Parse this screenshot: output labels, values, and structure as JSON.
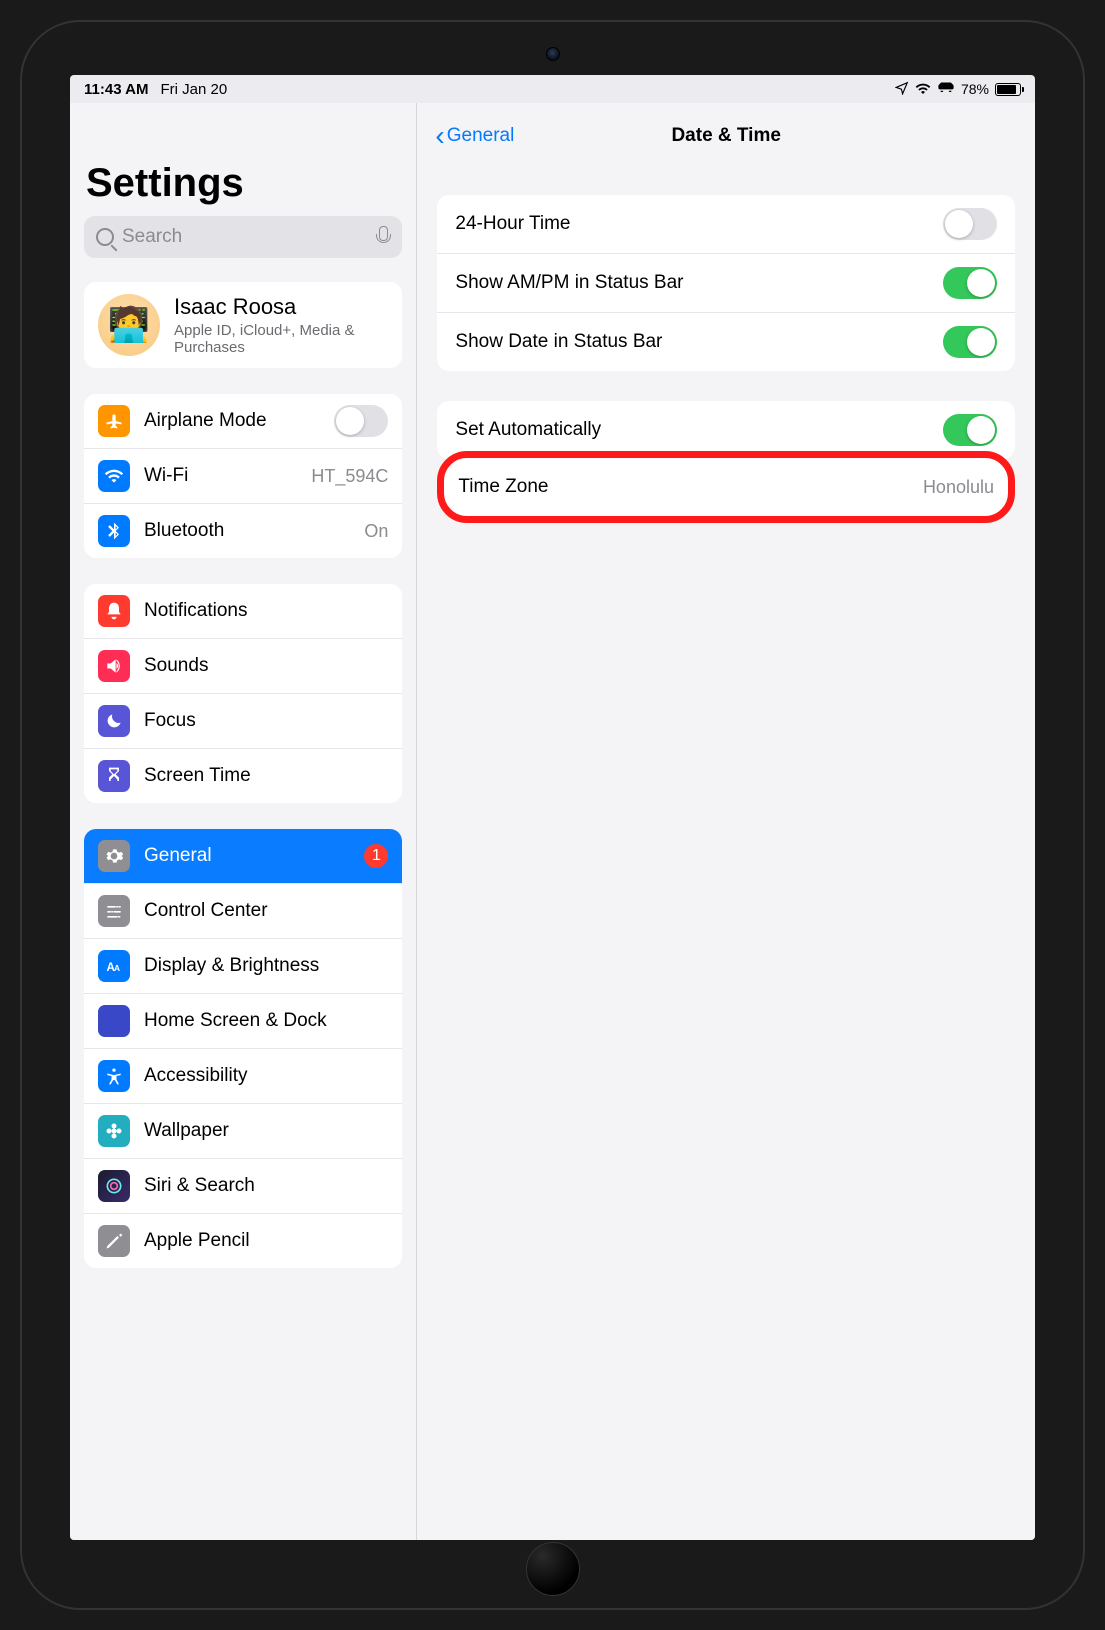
{
  "status": {
    "time": "11:43 AM",
    "date": "Fri Jan 20",
    "battery_pct": "78%"
  },
  "sidebar": {
    "title": "Settings",
    "search_placeholder": "Search",
    "profile": {
      "name": "Isaac Roosa",
      "subtitle": "Apple ID, iCloud+, Media & Purchases"
    },
    "group_network": {
      "airplane": "Airplane Mode",
      "wifi": "Wi-Fi",
      "wifi_value": "HT_594C",
      "bluetooth": "Bluetooth",
      "bluetooth_value": "On"
    },
    "group_attention": {
      "notifications": "Notifications",
      "sounds": "Sounds",
      "focus": "Focus",
      "screen_time": "Screen Time"
    },
    "group_system": {
      "general": "General",
      "general_badge": "1",
      "control_center": "Control Center",
      "display": "Display & Brightness",
      "home_screen": "Home Screen & Dock",
      "accessibility": "Accessibility",
      "wallpaper": "Wallpaper",
      "siri": "Siri & Search",
      "apple_pencil": "Apple Pencil"
    }
  },
  "detail": {
    "back_label": "General",
    "title": "Date & Time",
    "group_format": {
      "twenty_four_hour": "24-Hour Time",
      "twenty_four_hour_on": false,
      "show_ampm": "Show AM/PM in Status Bar",
      "show_ampm_on": true,
      "show_date": "Show Date in Status Bar",
      "show_date_on": true
    },
    "group_zone": {
      "set_auto": "Set Automatically",
      "set_auto_on": true,
      "timezone_label": "Time Zone",
      "timezone_value": "Honolulu"
    }
  }
}
